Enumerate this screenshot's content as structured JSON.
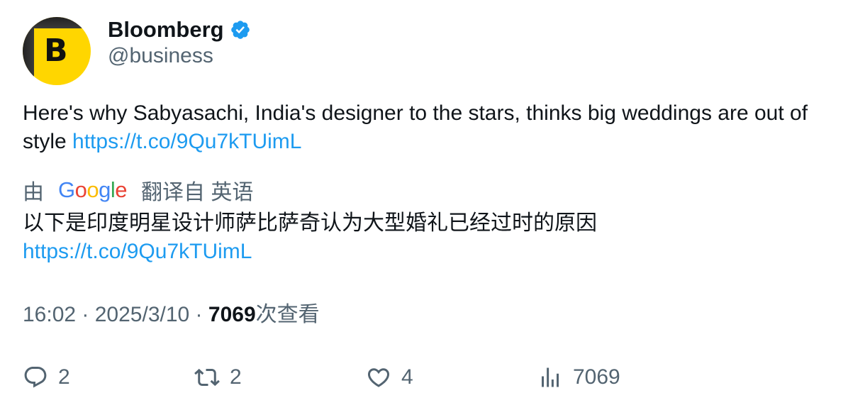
{
  "author": {
    "display_name": "Bloomberg",
    "handle": "@business",
    "avatar_letter": "B",
    "verified": true,
    "avatar_color": "#ffd600"
  },
  "tweet": {
    "text": "Here's why Sabyasachi, India's designer to the stars, thinks big weddings are out of style ",
    "link": "https://t.co/9Qu7kTUimL"
  },
  "translation": {
    "prefix": "由",
    "provider": "Google",
    "suffix": "翻译自 英语",
    "text": "以下是印度明星设计师萨比萨奇认为大型婚礼已经过时的原因",
    "link": "https://t.co/9Qu7kTUimL"
  },
  "meta": {
    "time": "16:02",
    "date": "2025/3/10",
    "separator": " · ",
    "views": "7069",
    "views_label": "次查看"
  },
  "actions": {
    "replies": "2",
    "retweets": "2",
    "likes": "4",
    "views": "7069"
  },
  "colors": {
    "link": "#1d9bf0",
    "verified": "#1d9bf0",
    "muted": "#536471",
    "text": "#0f1419"
  },
  "icons": [
    "verified-badge-icon",
    "reply-icon",
    "retweet-icon",
    "like-icon",
    "views-icon"
  ]
}
